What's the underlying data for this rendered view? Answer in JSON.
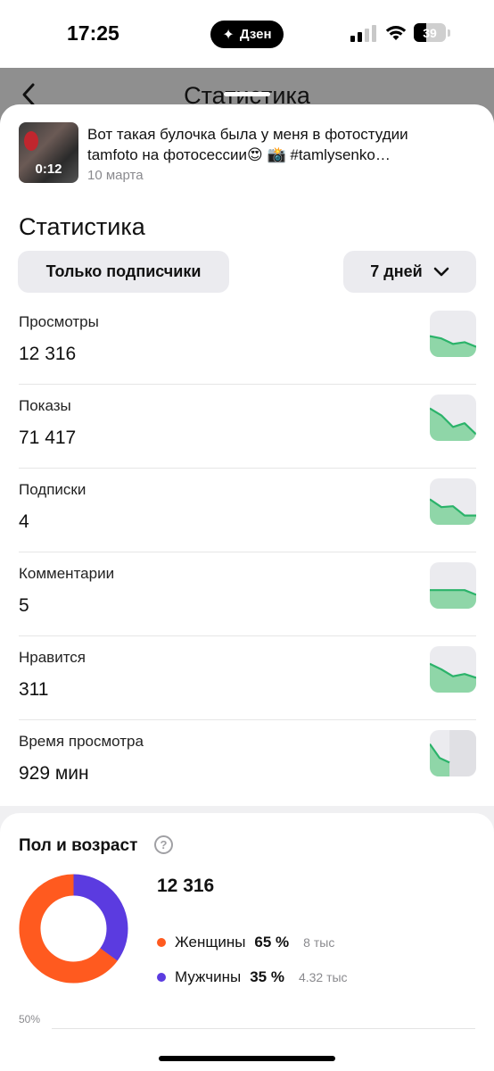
{
  "status_bar": {
    "time": "17:25",
    "app_pill": "Дзен",
    "battery": "39"
  },
  "header": {
    "back_icon": "chevron-left-icon",
    "title": "Статистика"
  },
  "post": {
    "duration": "0:12",
    "text": "Вот такая булочка была у меня в фотостудии tamfoto на фотосессии😍 📸 #tamlysenko…",
    "date": "10 марта"
  },
  "stats": {
    "title": "Статистика",
    "filter_label": "Только подписчики",
    "period_label": "7 дней",
    "metrics": [
      {
        "label": "Просмотры",
        "value": "12 316",
        "trend": [
          0.55,
          0.6,
          0.72,
          0.68,
          0.78
        ]
      },
      {
        "label": "Показы",
        "value": "71 417",
        "trend": [
          0.3,
          0.45,
          0.7,
          0.62,
          0.86
        ]
      },
      {
        "label": "Подписки",
        "value": "4",
        "trend": [
          0.45,
          0.62,
          0.6,
          0.8,
          0.8
        ]
      },
      {
        "label": "Комментарии",
        "value": "5",
        "trend": [
          0.6,
          0.6,
          0.6,
          0.6,
          0.7
        ]
      },
      {
        "label": "Нравится",
        "value": "311",
        "trend": [
          0.38,
          0.5,
          0.65,
          0.6,
          0.68
        ]
      },
      {
        "label": "Время просмотра",
        "value": "929 мин",
        "trend": [
          0.3,
          0.6,
          0.7
        ]
      }
    ]
  },
  "demographics": {
    "title": "Пол и возраст",
    "total": "12 316",
    "female": {
      "label": "Женщины",
      "percent": "65 %",
      "count": "8 тыс",
      "share": 0.65,
      "color": "#ff5a1f"
    },
    "male": {
      "label": "Мужчины",
      "percent": "35 %",
      "count": "4.32 тыс",
      "share": 0.35,
      "color": "#5b3be0"
    },
    "axis_label": "50%"
  },
  "colors": {
    "spark_line": "#2bb36a",
    "spark_fill": "#8fd6a8"
  }
}
